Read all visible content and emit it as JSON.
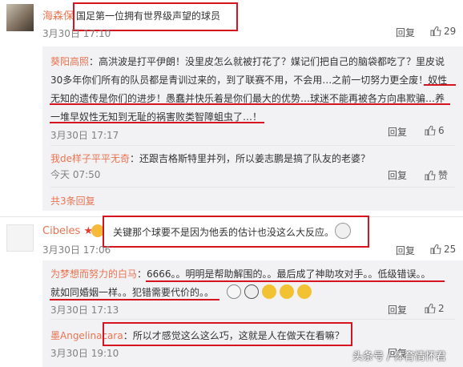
{
  "comments": [
    {
      "user": "海森保",
      "text": "国足第一位拥有世界级声望的球员",
      "time": "3月30日 17:10",
      "reply_label": "回复",
      "likes": "29"
    },
    {
      "user": "Cibeles",
      "badge": "★",
      "text": "关键那个球要不是因为他丢的估计也没这么大反应。",
      "time": "3月30日 17:06",
      "reply_label": "回复",
      "likes": "25"
    }
  ],
  "replies1": [
    {
      "user": "葵阳高照",
      "line1": "：高洪波是打平伊朗！没里皮怎么就被打花了？媒记们把自己的脑袋都吃了？里皮说",
      "line2": "30多年你们所有的队员都是青训过来的，到了联赛不用，不会用…之前一切努力更全废！奴性",
      "line3": "无知的遗传是你们的进步！愚蠢并快乐着是你们最大的优势…球迷不能再被各方向串欺骗…养",
      "line4": "一堆早奴性无知到无耻的祸害败类智障蛆虫了…！",
      "time": "3月30日 17:17",
      "reply_label": "回复",
      "likes": "6"
    },
    {
      "user": "我de样子平平无奇",
      "text": "：还跟吉格斯特里并列，所以姜志鹏是搞了队友的老婆？",
      "time": "今天 07:50",
      "reply_label": "回复",
      "likes": "赞"
    }
  ],
  "more_replies": "共3条回复",
  "replies2": [
    {
      "user": "为梦想而努力的白马",
      "line1": "：6666。。明明是帮助解围的。。最后成了神助攻对手。。低级错误。。",
      "line2": "就如同婚姻一样。。犯错需要代价的。。",
      "time": "3月30日 17:13",
      "reply_label": "回复",
      "likes": "2"
    },
    {
      "user": "墨Angelinacara",
      "text": "：所以才感觉这么这么巧，这就是人在做天在看嘛？",
      "time": "3月30日 19:10",
      "reply_label": "回复"
    }
  ],
  "watermark": "头条号 / 体育情怀君",
  "colors": {
    "accent": "#eb7350",
    "highlight": "#d6131e",
    "panel": "#f2f2f5"
  }
}
